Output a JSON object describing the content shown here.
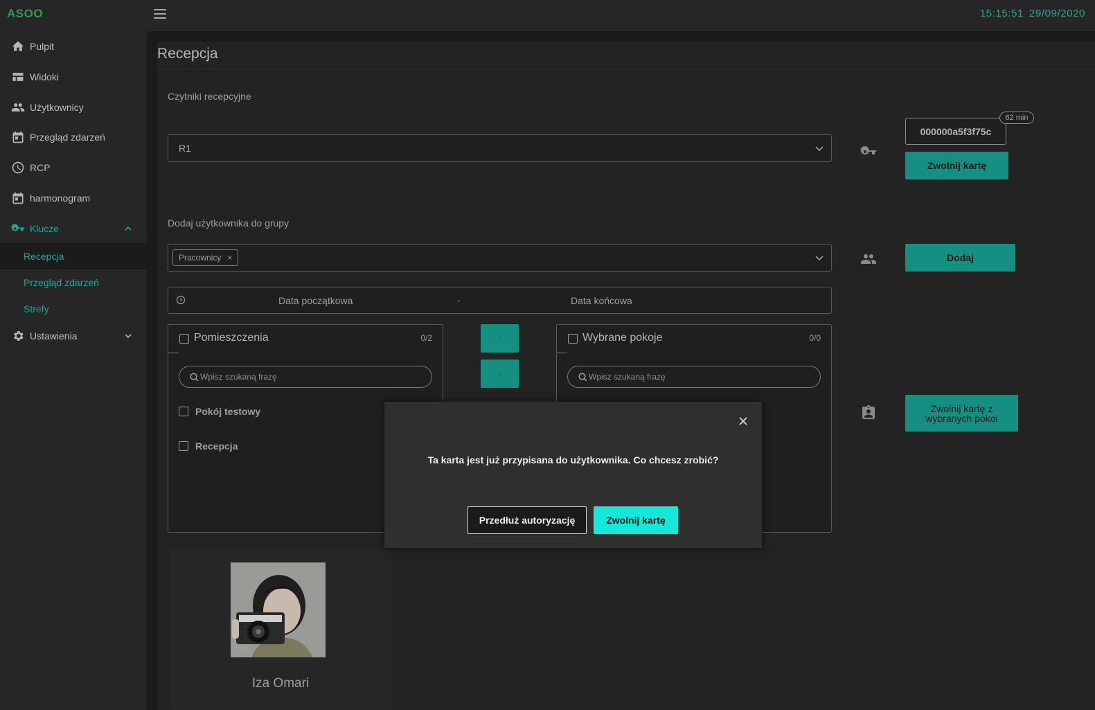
{
  "app": {
    "logo": "ASOO"
  },
  "header": {
    "time": "15:15:51",
    "date": "29/09/2020",
    "menu_icon": "hamburger-menu-icon"
  },
  "sidebar": {
    "items": [
      {
        "label": "Pulpit",
        "icon": "home-icon"
      },
      {
        "label": "Widoki",
        "icon": "view-quilt-icon"
      },
      {
        "label": "Użytkownicy",
        "icon": "people-icon"
      },
      {
        "label": "Przegląd zdarzeń",
        "icon": "calendar-icon"
      },
      {
        "label": "RCP",
        "icon": "clock-icon"
      },
      {
        "label": "harmonogram",
        "icon": "calendar-icon"
      },
      {
        "label": "Klucze",
        "icon": "key-icon",
        "expanded": true
      },
      {
        "label": "Ustawienia",
        "icon": "gear-icon",
        "expanded": false
      }
    ],
    "subitems": [
      {
        "label": "Recepcja",
        "selected": true
      },
      {
        "label": "Przegląd zdarzeń"
      },
      {
        "label": "Strefy"
      }
    ]
  },
  "page": {
    "title": "Recepcja",
    "readers_label": "Czytniki recepcyjne",
    "reader_value": "R1",
    "card_code": "000000a5f3f75c",
    "card_badge": "62 min",
    "release_card_btn": "Zwolnij kartę",
    "group_label": "Dodaj użytkownika do grupy",
    "group_tag": "Pracownicy",
    "tag_remove": "×",
    "add_btn": "Dodaj",
    "date_start": "Data początkowa",
    "date_sep": "-",
    "date_end": "Data końcowa",
    "release_rooms_btn": "Zwolnij kartę z wybranych pokoi"
  },
  "transfer": {
    "left": {
      "title": "Pomieszczenia",
      "count": "0/2",
      "search_placeholder": "Wpisz szukaną frazę",
      "items": [
        "Pokój testowy",
        "Recepcja"
      ]
    },
    "right": {
      "title": "Wybrane pokoje",
      "count": "0/0",
      "search_placeholder": "Wpisz szukaną frazę",
      "items": []
    }
  },
  "user": {
    "name": "Iza Omari"
  },
  "modal": {
    "message": "Ta karta jest już przypisana do użytkownika. Co chcesz zrobić?",
    "extend_btn": "Przedłuż autoryzację",
    "release_btn": "Zwolnij kartę"
  },
  "colors": {
    "accent": "#1ea996",
    "button": "#158f81",
    "primary": "#15e8d8",
    "logo": "#2e9d4a"
  }
}
